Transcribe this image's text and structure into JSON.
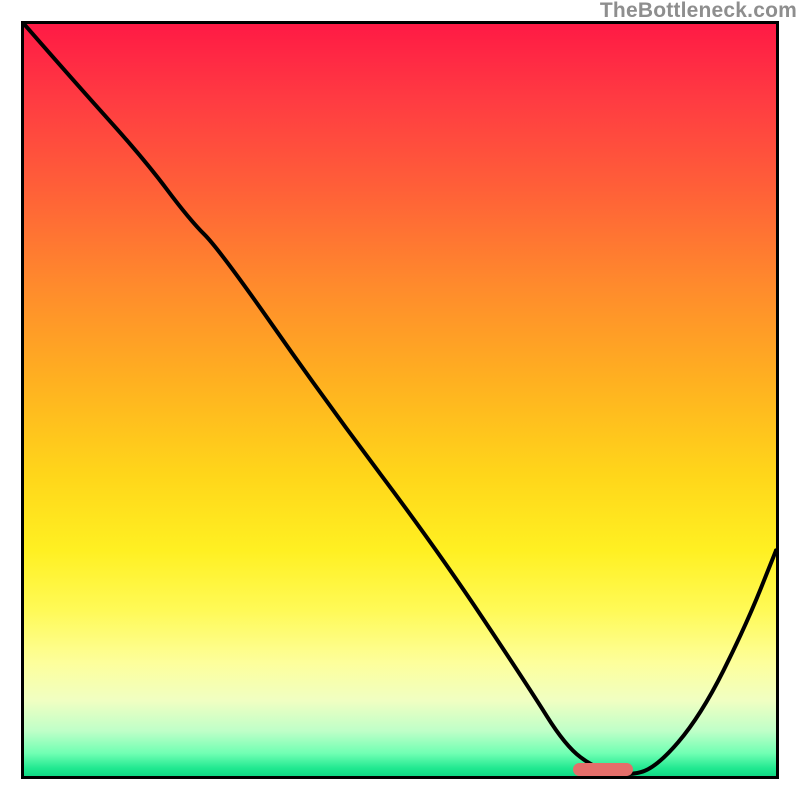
{
  "watermark": "TheBottleneck.com",
  "chart_data": {
    "type": "line",
    "title": "",
    "xlabel": "",
    "ylabel": "",
    "xlim": [
      0,
      100
    ],
    "ylim": [
      0,
      100
    ],
    "grid": false,
    "legend": false,
    "background": "rainbow-vertical-gradient",
    "gradient_colors_top_to_bottom": [
      "#ff1a45",
      "#ff8b2c",
      "#ffd61a",
      "#fdff9c",
      "#20e890"
    ],
    "series": [
      {
        "name": "bottleneck-curve",
        "color": "#000000",
        "x": [
          0,
          7,
          16,
          22,
          26,
          40,
          55,
          67,
          72,
          76,
          80,
          84,
          90,
          96,
          100
        ],
        "y": [
          100,
          92,
          82,
          74,
          70,
          50,
          30,
          12,
          4,
          1,
          0,
          1,
          8,
          20,
          30
        ]
      }
    ],
    "marker": {
      "name": "optimal-range",
      "color": "#e46e6a",
      "x_start": 73,
      "x_end": 81,
      "y": 0.8
    }
  }
}
